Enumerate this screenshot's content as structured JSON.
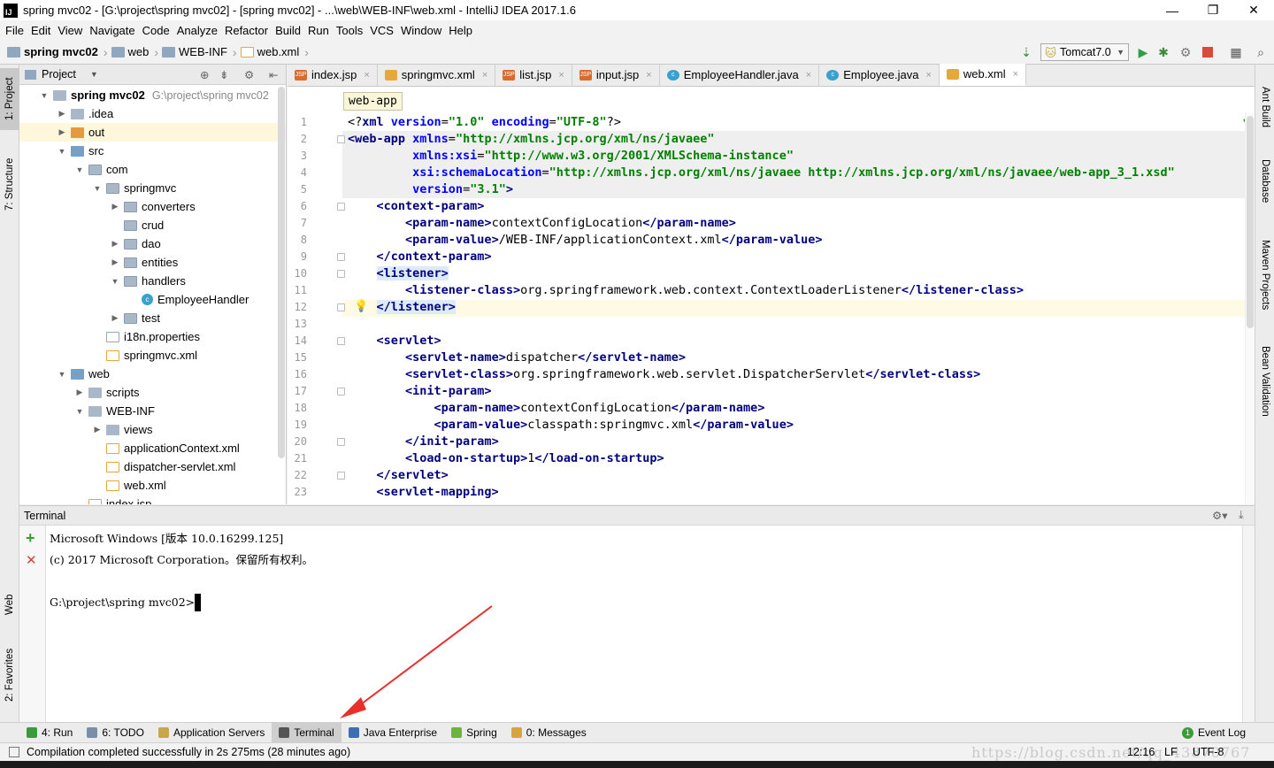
{
  "window": {
    "title": "spring mvc02 - [G:\\project\\spring mvc02] - [spring mvc02] - ...\\web\\WEB-INF\\web.xml - IntelliJ IDEA 2017.1.6",
    "app_icon_label": "IJ",
    "minimize": "—",
    "maximize": "❐",
    "close": "✕"
  },
  "menu": [
    "File",
    "Edit",
    "View",
    "Navigate",
    "Code",
    "Analyze",
    "Refactor",
    "Build",
    "Run",
    "Tools",
    "VCS",
    "Window",
    "Help"
  ],
  "nav": {
    "crumbs": [
      "spring mvc02",
      "web",
      "WEB-INF",
      "web.xml"
    ],
    "run_config": "Tomcat7.0"
  },
  "left_stripe": {
    "project": "1: Project",
    "structure": "7: Structure",
    "web": "Web",
    "favorites": "2: Favorites"
  },
  "right_stripe": {
    "ant": "Ant Build",
    "database": "Database",
    "maven": "Maven Projects",
    "bean": "Bean Validation"
  },
  "project": {
    "header": "Project",
    "tree": [
      {
        "label": "spring mvc02",
        "sub": "G:\\project\\spring mvc02",
        "depth": 0,
        "arrow": "▼",
        "icon": "folder",
        "bold": true
      },
      {
        "label": ".idea",
        "depth": 1,
        "arrow": "▶",
        "icon": "folder"
      },
      {
        "label": "out",
        "depth": 1,
        "arrow": "▶",
        "icon": "out"
      },
      {
        "label": "src",
        "depth": 1,
        "arrow": "▼",
        "icon": "src"
      },
      {
        "label": "com",
        "depth": 2,
        "arrow": "▼",
        "icon": "pkg"
      },
      {
        "label": "springmvc",
        "depth": 3,
        "arrow": "▼",
        "icon": "pkg"
      },
      {
        "label": "converters",
        "depth": 4,
        "arrow": "▶",
        "icon": "pkg"
      },
      {
        "label": "crud",
        "depth": 4,
        "arrow": "",
        "icon": "pkg"
      },
      {
        "label": "dao",
        "depth": 4,
        "arrow": "▶",
        "icon": "pkg"
      },
      {
        "label": "entities",
        "depth": 4,
        "arrow": "▶",
        "icon": "pkg"
      },
      {
        "label": "handlers",
        "depth": 4,
        "arrow": "▼",
        "icon": "pkg"
      },
      {
        "label": "EmployeeHandler",
        "depth": 5,
        "arrow": "",
        "icon": "cls"
      },
      {
        "label": "test",
        "depth": 4,
        "arrow": "▶",
        "icon": "pkg"
      },
      {
        "label": "i18n.properties",
        "depth": 3,
        "arrow": "",
        "icon": "props"
      },
      {
        "label": "springmvc.xml",
        "depth": 3,
        "arrow": "",
        "icon": "xml"
      },
      {
        "label": "web",
        "depth": 1,
        "arrow": "▼",
        "icon": "src"
      },
      {
        "label": "scripts",
        "depth": 2,
        "arrow": "▶",
        "icon": "folder"
      },
      {
        "label": "WEB-INF",
        "depth": 2,
        "arrow": "▼",
        "icon": "folder"
      },
      {
        "label": "views",
        "depth": 3,
        "arrow": "▶",
        "icon": "folder"
      },
      {
        "label": "applicationContext.xml",
        "depth": 3,
        "arrow": "",
        "icon": "xml"
      },
      {
        "label": "dispatcher-servlet.xml",
        "depth": 3,
        "arrow": "",
        "icon": "xml"
      },
      {
        "label": "web.xml",
        "depth": 3,
        "arrow": "",
        "icon": "xml"
      },
      {
        "label": "index.jsp",
        "depth": 2,
        "arrow": "",
        "icon": "xml"
      }
    ]
  },
  "tabs": [
    {
      "label": "index.jsp",
      "kind": "jsp"
    },
    {
      "label": "springmvc.xml",
      "kind": "xml"
    },
    {
      "label": "list.jsp",
      "kind": "jsp"
    },
    {
      "label": "input.jsp",
      "kind": "jsp"
    },
    {
      "label": "EmployeeHandler.java",
      "kind": "java"
    },
    {
      "label": "Employee.java",
      "kind": "java"
    },
    {
      "label": "web.xml",
      "kind": "xml",
      "active": true
    }
  ],
  "editor": {
    "breadcrumb_tip": "web-app",
    "line_numbers": [
      "1",
      "2",
      "3",
      "4",
      "5",
      "6",
      "7",
      "8",
      "9",
      "10",
      "11",
      "12",
      "13",
      "14",
      "15",
      "16",
      "17",
      "18",
      "19",
      "20",
      "21",
      "22",
      "23"
    ],
    "lines": [
      [
        [
          "pi",
          "<?"
        ],
        [
          "tag",
          "xml "
        ],
        [
          "attr",
          "version"
        ],
        [
          "txt",
          "="
        ],
        [
          "val",
          "\"1.0\""
        ],
        [
          "txt",
          " "
        ],
        [
          "attr",
          "encoding"
        ],
        [
          "txt",
          "="
        ],
        [
          "val",
          "\"UTF-8\""
        ],
        [
          "pi",
          "?>"
        ]
      ],
      [
        [
          "tag",
          "<web-app "
        ],
        [
          "attr",
          "xmlns"
        ],
        [
          "txt",
          "="
        ],
        [
          "val",
          "\"http://xmlns.jcp.org/xml/ns/javaee\""
        ]
      ],
      [
        [
          "txt",
          "         "
        ],
        [
          "attr",
          "xmlns:xsi"
        ],
        [
          "txt",
          "="
        ],
        [
          "val",
          "\"http://www.w3.org/2001/XMLSchema-instance\""
        ]
      ],
      [
        [
          "txt",
          "         "
        ],
        [
          "attr",
          "xsi:schemaLocation"
        ],
        [
          "txt",
          "="
        ],
        [
          "val",
          "\"http://xmlns.jcp.org/xml/ns/javaee http://xmlns.jcp.org/xml/ns/javaee/web-app_3_1.xsd\""
        ]
      ],
      [
        [
          "txt",
          "         "
        ],
        [
          "attr",
          "version"
        ],
        [
          "txt",
          "="
        ],
        [
          "val",
          "\"3.1\""
        ],
        [
          "tag",
          ">"
        ]
      ],
      [
        [
          "txt",
          "    "
        ],
        [
          "tag",
          "<context-param>"
        ]
      ],
      [
        [
          "txt",
          "        "
        ],
        [
          "tag",
          "<param-name>"
        ],
        [
          "txt",
          "contextConfigLocation"
        ],
        [
          "tag",
          "</param-name>"
        ]
      ],
      [
        [
          "txt",
          "        "
        ],
        [
          "tag",
          "<param-value>"
        ],
        [
          "txt",
          "/WEB-INF/applicationContext.xml"
        ],
        [
          "tag",
          "</param-value>"
        ]
      ],
      [
        [
          "txt",
          "    "
        ],
        [
          "tag",
          "</context-param>"
        ]
      ],
      [
        [
          "txt",
          "    "
        ],
        [
          "taghl",
          "<listener>"
        ]
      ],
      [
        [
          "txt",
          "        "
        ],
        [
          "tag",
          "<listener-class>"
        ],
        [
          "txt",
          "org.springframework.web.context.ContextLoaderListener"
        ],
        [
          "tag",
          "</listener-class>"
        ]
      ],
      [
        [
          "txt",
          "    "
        ],
        [
          "taghl",
          "</listener>"
        ]
      ],
      [
        [
          "txt",
          ""
        ]
      ],
      [
        [
          "txt",
          "    "
        ],
        [
          "tag",
          "<servlet>"
        ]
      ],
      [
        [
          "txt",
          "        "
        ],
        [
          "tag",
          "<servlet-name>"
        ],
        [
          "txt",
          "dispatcher"
        ],
        [
          "tag",
          "</servlet-name>"
        ]
      ],
      [
        [
          "txt",
          "        "
        ],
        [
          "tag",
          "<servlet-class>"
        ],
        [
          "txt",
          "org.springframework.web.servlet.DispatcherServlet"
        ],
        [
          "tag",
          "</servlet-class>"
        ]
      ],
      [
        [
          "txt",
          "        "
        ],
        [
          "tag",
          "<init-param>"
        ]
      ],
      [
        [
          "txt",
          "            "
        ],
        [
          "tag",
          "<param-name>"
        ],
        [
          "txt",
          "contextConfigLocation"
        ],
        [
          "tag",
          "</param-name>"
        ]
      ],
      [
        [
          "txt",
          "            "
        ],
        [
          "tag",
          "<param-value>"
        ],
        [
          "txt",
          "classpath:springmvc.xml"
        ],
        [
          "tag",
          "</param-value>"
        ]
      ],
      [
        [
          "txt",
          "        "
        ],
        [
          "tag",
          "</init-param>"
        ]
      ],
      [
        [
          "txt",
          "        "
        ],
        [
          "tag",
          "<load-on-startup>"
        ],
        [
          "txt",
          "1"
        ],
        [
          "tag",
          "</load-on-startup>"
        ]
      ],
      [
        [
          "txt",
          "    "
        ],
        [
          "tag",
          "</servlet>"
        ]
      ],
      [
        [
          "txt",
          "    "
        ],
        [
          "tag",
          "<servlet-mapping>"
        ]
      ]
    ]
  },
  "terminal": {
    "title": "Terminal",
    "lines": [
      "Microsoft Windows [版本 10.0.16299.125]",
      "(c) 2017 Microsoft Corporation。保留所有权利。",
      "",
      "G:\\project\\spring mvc02>"
    ],
    "add_label": "+",
    "close_label": "✕"
  },
  "toolwindows": [
    {
      "label": "4: Run",
      "color": "#3a9b3a"
    },
    {
      "label": "6: TODO",
      "color": "#7a8ea8"
    },
    {
      "label": "Application Servers",
      "color": "#c8a64a"
    },
    {
      "label": "Terminal",
      "color": "#555555",
      "active": true
    },
    {
      "label": "Java Enterprise",
      "color": "#3c6fb4"
    },
    {
      "label": "Spring",
      "color": "#6db33f"
    },
    {
      "label": "0: Messages",
      "color": "#d8a440"
    }
  ],
  "event_log": "Event Log",
  "status": {
    "message": "Compilation completed successfully in 2s 275ms (28 minutes ago)",
    "position": "12:16",
    "line_sep": "LF",
    "encoding": "UTF-8",
    "watermark": "https://blog.csdn.net/qq_43870767"
  },
  "colors": {
    "accent_arrow": "#e8302a",
    "tag": "#000080",
    "attr": "#0000ff",
    "value": "#008000",
    "selection": "#dcebf7",
    "current_line": "#fffae3"
  }
}
